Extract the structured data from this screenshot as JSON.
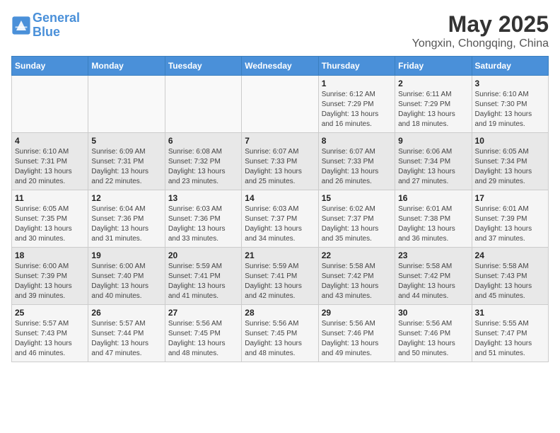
{
  "header": {
    "logo_line1": "General",
    "logo_line2": "Blue",
    "title": "May 2025",
    "subtitle": "Yongxin, Chongqing, China"
  },
  "columns": [
    "Sunday",
    "Monday",
    "Tuesday",
    "Wednesday",
    "Thursday",
    "Friday",
    "Saturday"
  ],
  "weeks": [
    [
      {
        "day": "",
        "info": ""
      },
      {
        "day": "",
        "info": ""
      },
      {
        "day": "",
        "info": ""
      },
      {
        "day": "",
        "info": ""
      },
      {
        "day": "1",
        "info": "Sunrise: 6:12 AM\nSunset: 7:29 PM\nDaylight: 13 hours\nand 16 minutes."
      },
      {
        "day": "2",
        "info": "Sunrise: 6:11 AM\nSunset: 7:29 PM\nDaylight: 13 hours\nand 18 minutes."
      },
      {
        "day": "3",
        "info": "Sunrise: 6:10 AM\nSunset: 7:30 PM\nDaylight: 13 hours\nand 19 minutes."
      }
    ],
    [
      {
        "day": "4",
        "info": "Sunrise: 6:10 AM\nSunset: 7:31 PM\nDaylight: 13 hours\nand 20 minutes."
      },
      {
        "day": "5",
        "info": "Sunrise: 6:09 AM\nSunset: 7:31 PM\nDaylight: 13 hours\nand 22 minutes."
      },
      {
        "day": "6",
        "info": "Sunrise: 6:08 AM\nSunset: 7:32 PM\nDaylight: 13 hours\nand 23 minutes."
      },
      {
        "day": "7",
        "info": "Sunrise: 6:07 AM\nSunset: 7:33 PM\nDaylight: 13 hours\nand 25 minutes."
      },
      {
        "day": "8",
        "info": "Sunrise: 6:07 AM\nSunset: 7:33 PM\nDaylight: 13 hours\nand 26 minutes."
      },
      {
        "day": "9",
        "info": "Sunrise: 6:06 AM\nSunset: 7:34 PM\nDaylight: 13 hours\nand 27 minutes."
      },
      {
        "day": "10",
        "info": "Sunrise: 6:05 AM\nSunset: 7:34 PM\nDaylight: 13 hours\nand 29 minutes."
      }
    ],
    [
      {
        "day": "11",
        "info": "Sunrise: 6:05 AM\nSunset: 7:35 PM\nDaylight: 13 hours\nand 30 minutes."
      },
      {
        "day": "12",
        "info": "Sunrise: 6:04 AM\nSunset: 7:36 PM\nDaylight: 13 hours\nand 31 minutes."
      },
      {
        "day": "13",
        "info": "Sunrise: 6:03 AM\nSunset: 7:36 PM\nDaylight: 13 hours\nand 33 minutes."
      },
      {
        "day": "14",
        "info": "Sunrise: 6:03 AM\nSunset: 7:37 PM\nDaylight: 13 hours\nand 34 minutes."
      },
      {
        "day": "15",
        "info": "Sunrise: 6:02 AM\nSunset: 7:37 PM\nDaylight: 13 hours\nand 35 minutes."
      },
      {
        "day": "16",
        "info": "Sunrise: 6:01 AM\nSunset: 7:38 PM\nDaylight: 13 hours\nand 36 minutes."
      },
      {
        "day": "17",
        "info": "Sunrise: 6:01 AM\nSunset: 7:39 PM\nDaylight: 13 hours\nand 37 minutes."
      }
    ],
    [
      {
        "day": "18",
        "info": "Sunrise: 6:00 AM\nSunset: 7:39 PM\nDaylight: 13 hours\nand 39 minutes."
      },
      {
        "day": "19",
        "info": "Sunrise: 6:00 AM\nSunset: 7:40 PM\nDaylight: 13 hours\nand 40 minutes."
      },
      {
        "day": "20",
        "info": "Sunrise: 5:59 AM\nSunset: 7:41 PM\nDaylight: 13 hours\nand 41 minutes."
      },
      {
        "day": "21",
        "info": "Sunrise: 5:59 AM\nSunset: 7:41 PM\nDaylight: 13 hours\nand 42 minutes."
      },
      {
        "day": "22",
        "info": "Sunrise: 5:58 AM\nSunset: 7:42 PM\nDaylight: 13 hours\nand 43 minutes."
      },
      {
        "day": "23",
        "info": "Sunrise: 5:58 AM\nSunset: 7:42 PM\nDaylight: 13 hours\nand 44 minutes."
      },
      {
        "day": "24",
        "info": "Sunrise: 5:58 AM\nSunset: 7:43 PM\nDaylight: 13 hours\nand 45 minutes."
      }
    ],
    [
      {
        "day": "25",
        "info": "Sunrise: 5:57 AM\nSunset: 7:43 PM\nDaylight: 13 hours\nand 46 minutes."
      },
      {
        "day": "26",
        "info": "Sunrise: 5:57 AM\nSunset: 7:44 PM\nDaylight: 13 hours\nand 47 minutes."
      },
      {
        "day": "27",
        "info": "Sunrise: 5:56 AM\nSunset: 7:45 PM\nDaylight: 13 hours\nand 48 minutes."
      },
      {
        "day": "28",
        "info": "Sunrise: 5:56 AM\nSunset: 7:45 PM\nDaylight: 13 hours\nand 48 minutes."
      },
      {
        "day": "29",
        "info": "Sunrise: 5:56 AM\nSunset: 7:46 PM\nDaylight: 13 hours\nand 49 minutes."
      },
      {
        "day": "30",
        "info": "Sunrise: 5:56 AM\nSunset: 7:46 PM\nDaylight: 13 hours\nand 50 minutes."
      },
      {
        "day": "31",
        "info": "Sunrise: 5:55 AM\nSunset: 7:47 PM\nDaylight: 13 hours\nand 51 minutes."
      }
    ]
  ]
}
